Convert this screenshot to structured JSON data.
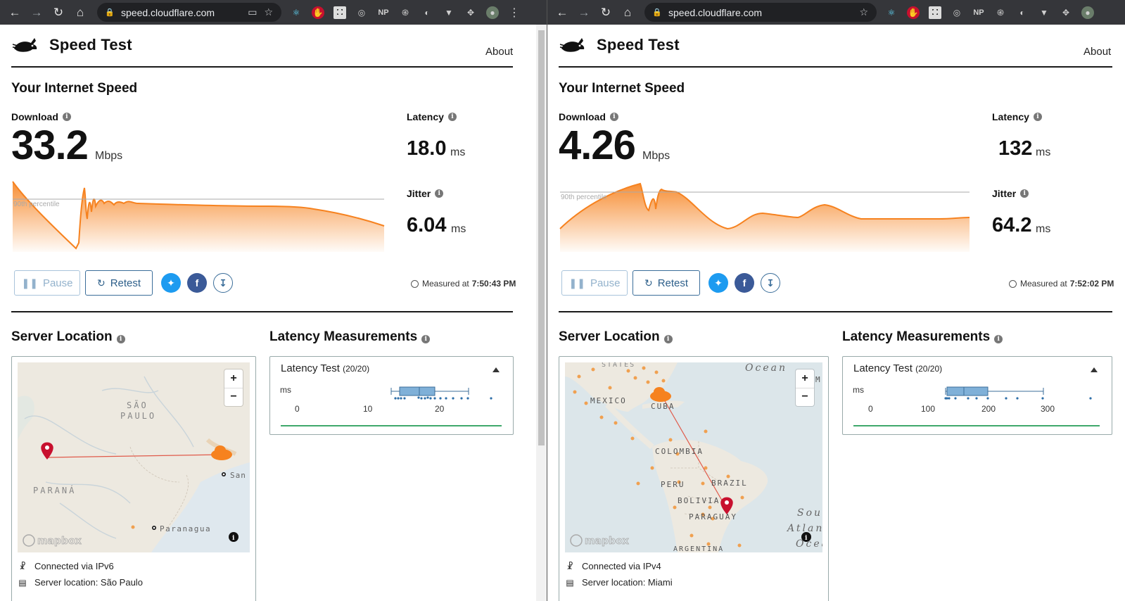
{
  "windows": [
    {
      "browser": {
        "url": "speed.cloudflare.com"
      },
      "site": {
        "title": "Speed Test",
        "about": "About"
      },
      "section_title": "Your Internet Speed",
      "download": {
        "label": "Download",
        "value": "33.2",
        "unit": "Mbps"
      },
      "latency": {
        "label": "Latency",
        "value": "18.0",
        "unit": "ms"
      },
      "jitter": {
        "label": "Jitter",
        "value": "6.04",
        "unit": "ms"
      },
      "percentile_label": "90th percentile",
      "buttons": {
        "pause": "Pause",
        "retest": "Retest"
      },
      "measured": {
        "label": "Measured at",
        "time": "7:50:43 PM"
      },
      "server_location": {
        "title": "Server Location",
        "labels": [
          "SÃO",
          "PAULO",
          "PARANÁ",
          "Paranagua",
          "San"
        ],
        "connected": "Connected via IPv6",
        "server": "Server location: São Paulo",
        "attribution": "mapbox"
      },
      "latency_measurements": {
        "title": "Latency Measurements",
        "test_label": "Latency Test",
        "count": "(20/20)",
        "unit": "ms",
        "ticks": [
          "0",
          "10",
          "20"
        ]
      }
    },
    {
      "browser": {
        "url": "speed.cloudflare.com"
      },
      "site": {
        "title": "Speed Test",
        "about": "About"
      },
      "section_title": "Your Internet Speed",
      "download": {
        "label": "Download",
        "value": "4.26",
        "unit": "Mbps"
      },
      "latency": {
        "label": "Latency",
        "value": "132",
        "unit": "ms"
      },
      "jitter": {
        "label": "Jitter",
        "value": "64.2",
        "unit": "ms"
      },
      "percentile_label": "90th percentile",
      "buttons": {
        "pause": "Pause",
        "retest": "Retest"
      },
      "measured": {
        "label": "Measured at",
        "time": "7:52:02 PM"
      },
      "server_location": {
        "title": "Server Location",
        "labels": [
          "STATES",
          "Ocean",
          "MEXICO",
          "CUBA",
          "COLOMBIA",
          "PERU",
          "BRAZIL",
          "BOLIVIA",
          "PARAGUAY",
          "ARGENTINA",
          "Sou",
          "Atlan",
          "Ocea",
          "M"
        ],
        "connected": "Connected via IPv4",
        "server": "Server location: Miami",
        "attribution": "mapbox"
      },
      "latency_measurements": {
        "title": "Latency Measurements",
        "test_label": "Latency Test",
        "count": "(20/20)",
        "unit": "ms",
        "ticks": [
          "0",
          "100",
          "200",
          "300"
        ]
      }
    }
  ],
  "colors": {
    "accent": "#f6821f",
    "link": "#2d5f8a",
    "twitter": "#1d9bf0",
    "facebook": "#3b5a98",
    "pin": "#c8102e",
    "box": "#7fb0d8",
    "green": "#3fa86b"
  },
  "icons": [
    "back-icon",
    "forward-icon",
    "reload-icon",
    "home-icon",
    "lock-icon",
    "cast-icon",
    "star-icon",
    "extensions-icon",
    "rabbit-logo-icon",
    "info-icon",
    "pause-icon",
    "retest-icon",
    "twitter-icon",
    "facebook-icon",
    "download-icon",
    "clock-icon",
    "map-pin-icon",
    "cloud-icon",
    "network-icon",
    "server-icon",
    "caret-up-icon"
  ]
}
